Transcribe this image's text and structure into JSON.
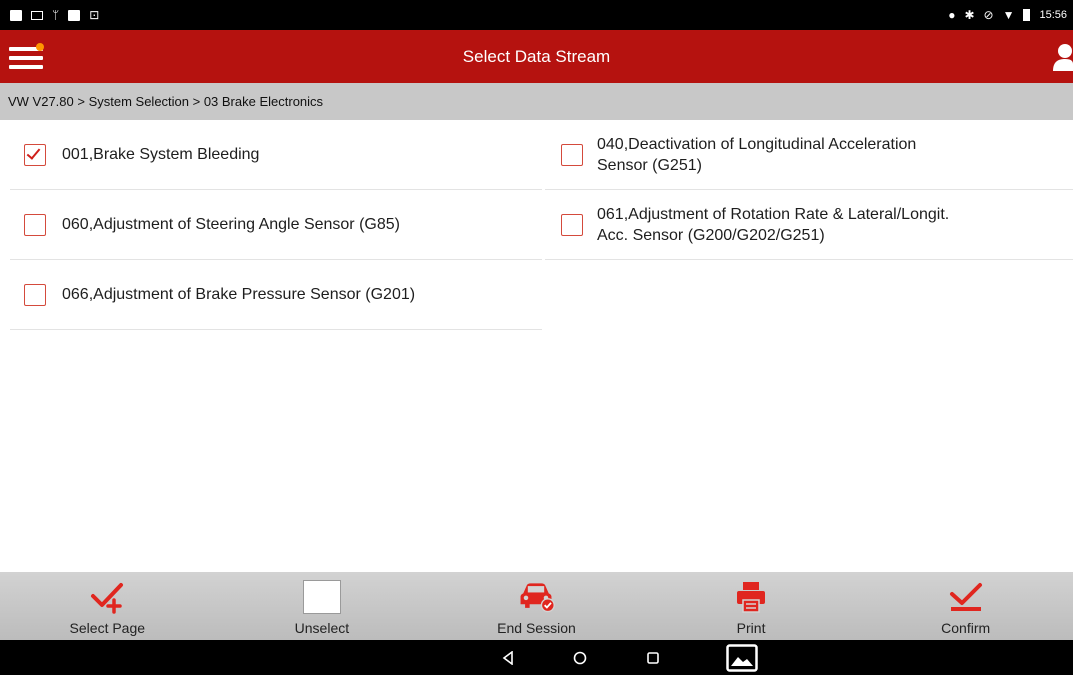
{
  "status_bar": {
    "left_icons": [
      "image-icon",
      "cast-icon",
      "usb-icon",
      "image-icon",
      "screenshot-icon"
    ],
    "right_icons": [
      "location-icon",
      "bluetooth-icon",
      "do-not-disturb-icon",
      "wifi-icon",
      "battery-icon"
    ],
    "time": "15:56"
  },
  "app_bar": {
    "title": "Select Data Stream",
    "menu_icon": "hamburger-menu-icon",
    "notification_color": "#ff9500",
    "user_icon": "user-icon"
  },
  "breadcrumb": {
    "text": "VW V27.80 > System Selection > 03 Brake Electronics"
  },
  "items": [
    {
      "label": "001,Brake System Bleeding",
      "checked": true
    },
    {
      "label": "040,Deactivation of Longitudinal Acceleration Sensor (G251)",
      "line1": "040,Deactivation of Longitudinal Acceleration",
      "line2": "Sensor (G251)",
      "checked": false
    },
    {
      "label": "060,Adjustment of Steering Angle Sensor (G85)",
      "checked": false
    },
    {
      "label": "061,Adjustment of Rotation Rate & Lateral/Longit. Acc. Sensor (G200/G202/G251)",
      "line1": "061,Adjustment of Rotation Rate & Lateral/Longit.",
      "line2": "Acc. Sensor (G200/G202/G251)",
      "checked": false
    },
    {
      "label": "066,Adjustment of Brake Pressure Sensor (G201)",
      "checked": false
    }
  ],
  "toolbar": {
    "select_page": "Select Page",
    "unselect": "Unselect",
    "end_session": "End Session",
    "print": "Print",
    "confirm": "Confirm"
  },
  "nav_bar": {
    "buttons": [
      "back-icon",
      "home-icon",
      "recents-icon",
      "gallery-icon"
    ]
  },
  "colors": {
    "accent": "#b5120f",
    "checkbox_border": "#d44a3c",
    "toolbar_icon": "#e0261f"
  }
}
